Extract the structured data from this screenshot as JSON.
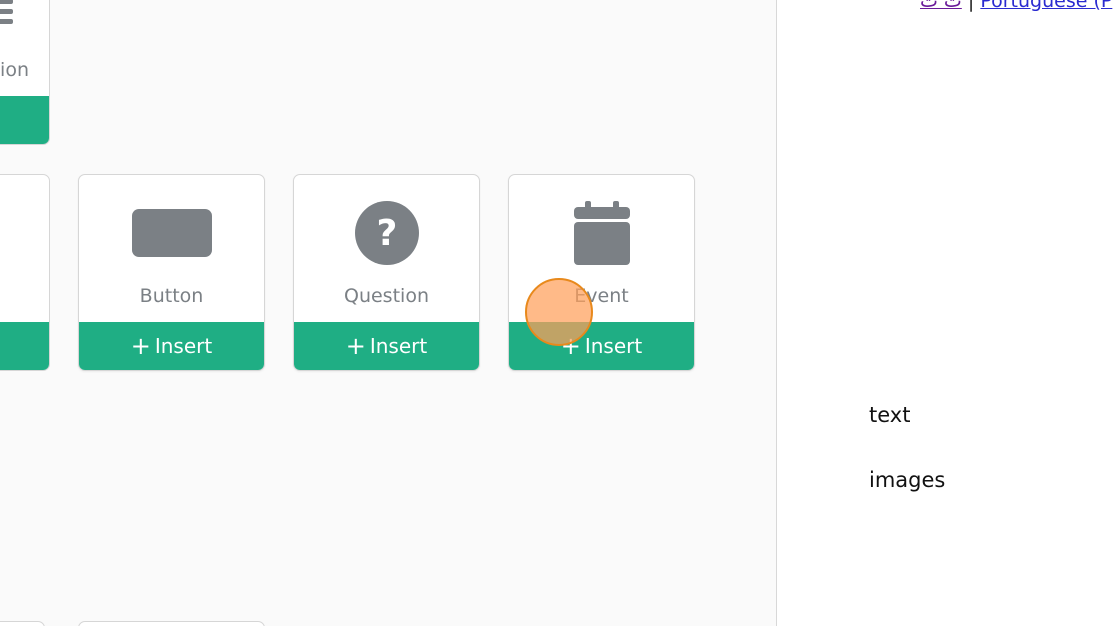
{
  "top_card": {
    "label": "ion"
  },
  "cards": [
    {
      "label": "Button",
      "insert_label": "Insert",
      "icon": "button-rectangle-icon"
    },
    {
      "label": "Question",
      "insert_label": "Insert",
      "icon": "question-circle-icon"
    },
    {
      "label": "Event",
      "insert_label": "Insert",
      "icon": "calendar-icon"
    }
  ],
  "right_panel": {
    "lang_prefix": "ت ت",
    "lang_separator": "|",
    "lang_link": "Portuguese (P",
    "menu_items": [
      "text",
      "images"
    ]
  },
  "colors": {
    "accent_green": "#1fae84",
    "icon_gray": "#7b8085",
    "cursor_orange": "#f5a05a"
  }
}
